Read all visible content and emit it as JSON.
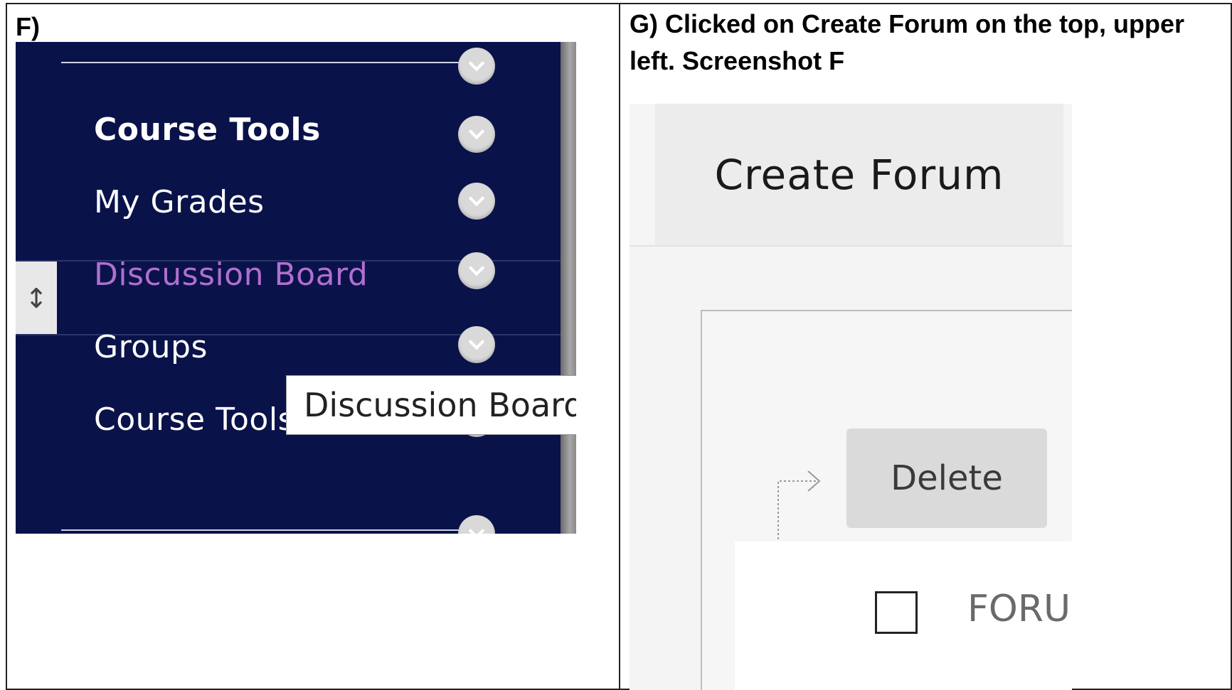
{
  "document": {
    "cell_f_label": "F)",
    "cell_g_label": "G) Clicked on Create Forum on the top, upper left. Screenshot F"
  },
  "course_menu": {
    "items": [
      {
        "label": "Course Tools",
        "style": "bold"
      },
      {
        "label": "My Grades",
        "style": "normal"
      },
      {
        "label": "Discussion Board",
        "style": "active"
      },
      {
        "label": "Groups",
        "style": "normal"
      },
      {
        "label": "Course Tools",
        "style": "normal"
      }
    ],
    "tooltip": "Discussion Board",
    "colors": {
      "background": "#0a124a",
      "active_text": "#b06fcf"
    }
  },
  "forum_page": {
    "create_button_label": "Create Forum",
    "delete_button_label": "Delete",
    "column_header": "FORU"
  }
}
